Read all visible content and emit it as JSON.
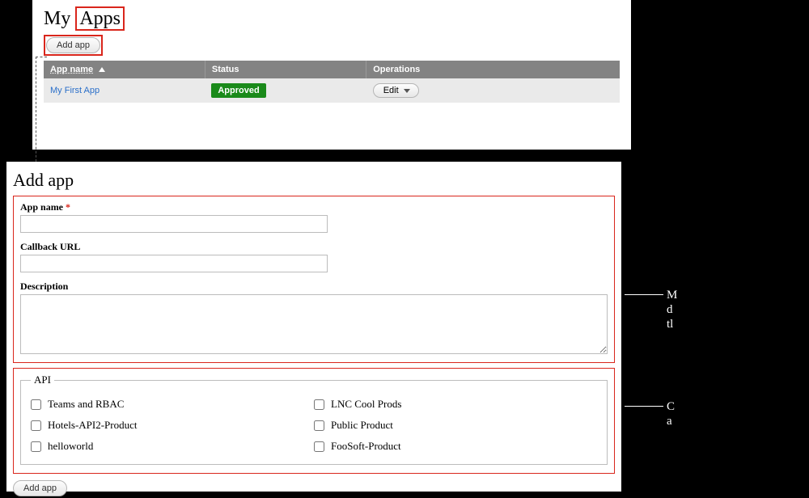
{
  "top": {
    "title_prefix": "My ",
    "title_highlight": "Apps",
    "add_app_label": "Add app",
    "table": {
      "headers": {
        "name": "App name",
        "status": "Status",
        "operations": "Operations"
      },
      "row": {
        "name": "My First App",
        "status": "Approved",
        "edit_label": "Edit"
      }
    }
  },
  "bottom": {
    "title": "Add app",
    "fields": {
      "app_name_label": "App name",
      "required_mark": "*",
      "callback_label": "Callback URL",
      "description_label": "Description"
    },
    "api": {
      "legend": "API",
      "left": [
        "Teams and RBAC",
        "Hotels-API2-Product",
        "helloworld"
      ],
      "right": [
        "LNC Cool Prods",
        "Public Product",
        "FooSoft-Product"
      ]
    },
    "submit_label": "Add app"
  },
  "annotations": {
    "right1_lines": [
      "M",
      "d",
      "tl"
    ],
    "right2_lines": [
      "C",
      "a"
    ]
  }
}
